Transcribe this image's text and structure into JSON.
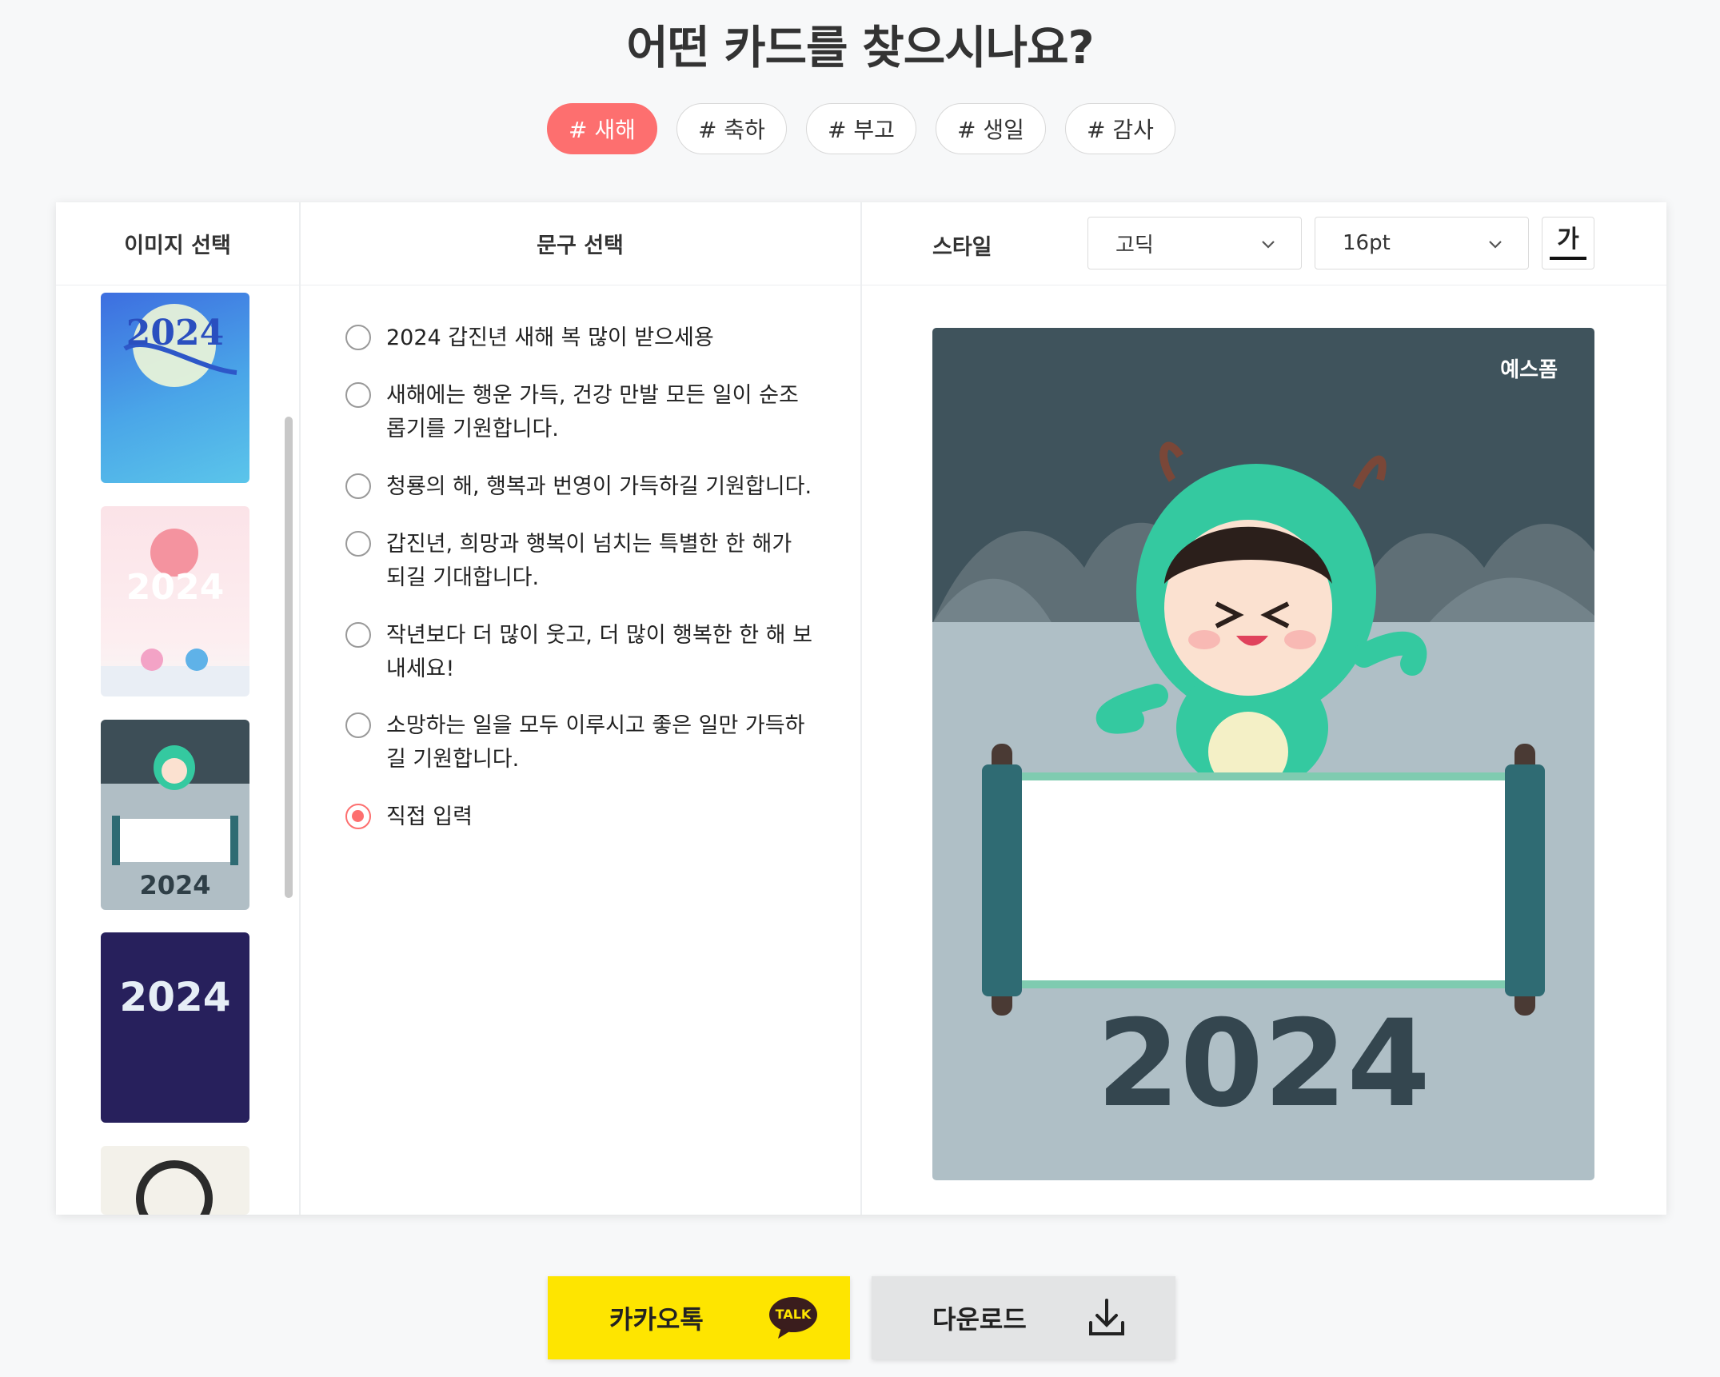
{
  "page": {
    "title": "어떤 카드를 찾으시나요?"
  },
  "tags": [
    "# 새해",
    "# 축하",
    "# 부고",
    "# 생일",
    "# 감사"
  ],
  "active_tag": "# 새해",
  "columns": {
    "image": "이미지 선택",
    "phrase": "문구 선택",
    "style": "스타일"
  },
  "thumbnails": [
    {
      "name": "thumb-blue-moon-dragon",
      "text": "2024"
    },
    {
      "name": "thumb-pink-fortune",
      "text": "2024"
    },
    {
      "name": "thumb-green-dragon-scroll",
      "text": "2024"
    },
    {
      "name": "thumb-navy-dragon",
      "text": "2024"
    },
    {
      "name": "thumb-dragon-emblem",
      "text": ""
    }
  ],
  "phrases": [
    "2024 갑진년 새해 복 많이 받으세용",
    "새해에는 행운 가득, 건강 만발 모든 일이 순조롭기를 기원합니다.",
    "청룡의 해, 행복과 번영이 가득하길 기원합니다.",
    "갑진년, 희망과 행복이 넘치는 특별한 한 해가 되길 기대합니다.",
    "작년보다 더 많이 웃고, 더 많이 행복한 한 해 보내세요!",
    "소망하는 일을 모두 이루시고 좋은 일만 가득하길 기원합니다.",
    "직접 입력"
  ],
  "selected_phrase": "직접 입력",
  "style": {
    "font": "고딕",
    "size": "16pt",
    "color_button": "가"
  },
  "preview": {
    "logo": "예스폼",
    "year": "2024"
  },
  "buttons": {
    "kakao": "카카오톡",
    "kakao_badge": "TALK",
    "download": "다운로드"
  },
  "colors": {
    "accent": "#fd6f6f",
    "kakao": "#fee500",
    "download": "#e3e4e5"
  }
}
